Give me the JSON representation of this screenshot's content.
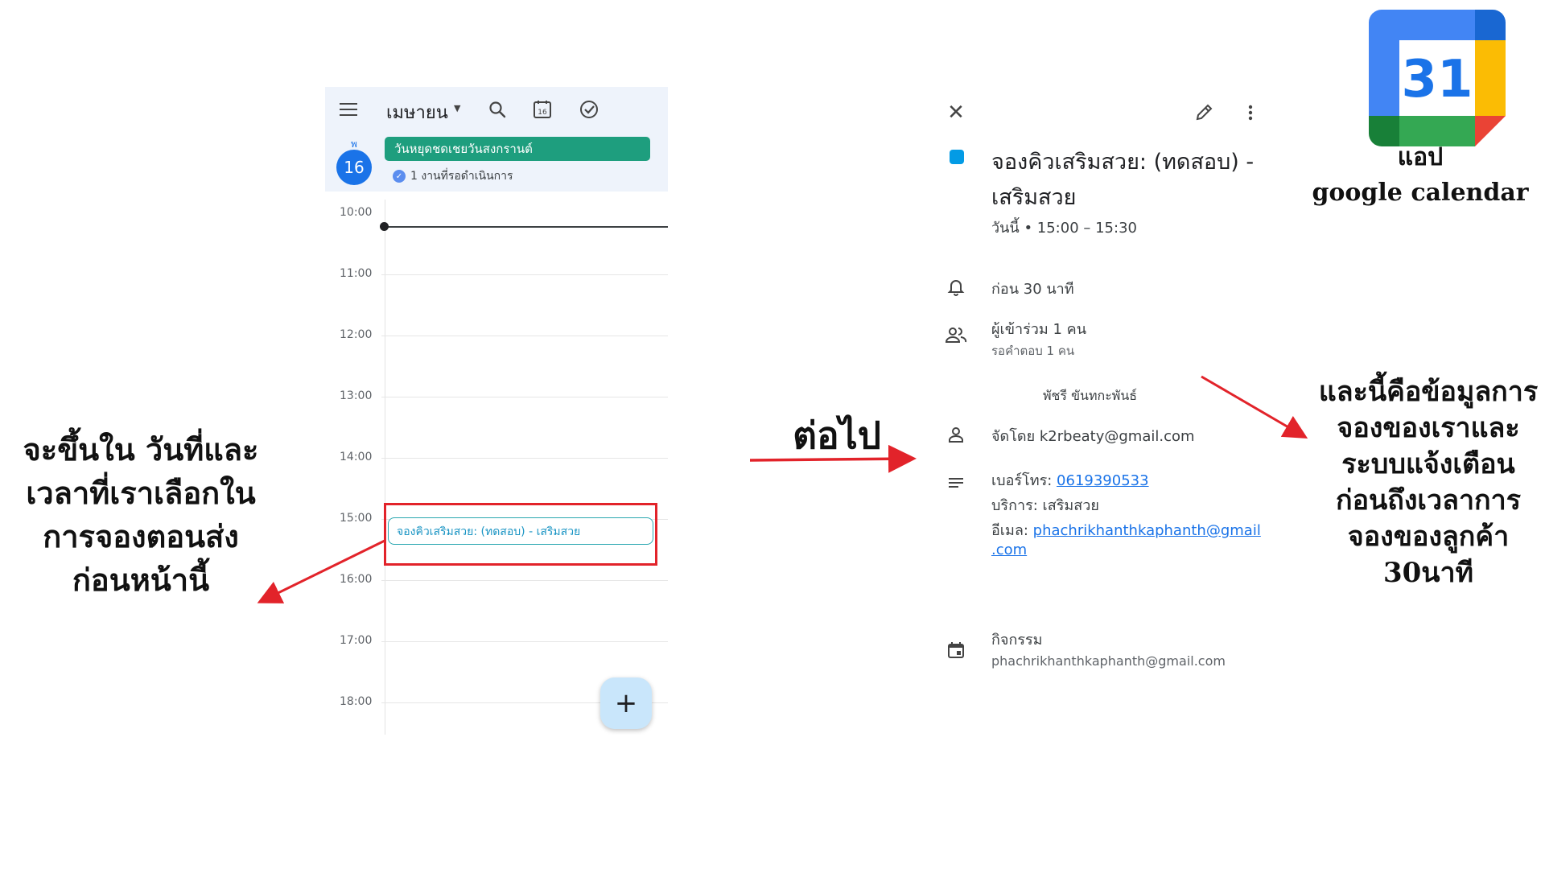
{
  "calendar_view": {
    "month_label": "เมษายน",
    "day_letter": "พ",
    "day_number": "16",
    "today_icon_number": "16",
    "holiday_event": "วันหยุดชดเชยวันสงกรานต์",
    "pending_tasks": "1 งานที่รอดำเนินการ",
    "hours": [
      "10:00",
      "11:00",
      "12:00",
      "13:00",
      "14:00",
      "15:00",
      "16:00",
      "17:00",
      "18:00"
    ],
    "event_chip": "จองคิวเสริมสวย: (ทดสอบ) - เสริมสวย",
    "fab_label": "+"
  },
  "event_detail": {
    "title": "จองคิวเสริมสวย: (ทดสอบ) - เสริมสวย",
    "time": "วันนี้  •  15:00 – 15:30",
    "reminder": "ก่อน 30 นาที",
    "guests_count": "ผู้เข้าร่วม 1 คน",
    "guests_pending": "รอคำตอบ 1 คน",
    "guest_name": "พัชรี ขันทกะพันธ์",
    "organizer": "จัดโดย k2rbeaty@gmail.com",
    "phone_label": "เบอร์โทร: ",
    "phone": "0619390533",
    "service": "บริการ: เสริมสวย",
    "email_label": "อีเมล: ",
    "email_line1": "phachrikhanthkaphanth@gmail",
    "email_line2": ".com",
    "calendar_name": "กิจกรรม",
    "calendar_owner": "phachrikhanthkaphanth@gmail.com",
    "color": "#039be5"
  },
  "annotations": {
    "left_note": [
      "จะขึ้นใน วันที่และ",
      "เวลาที่เราเลือกใน",
      "การจองตอนส่ง",
      "ก่อนหน้านี้"
    ],
    "next_note": "ต่อไป",
    "right_note": [
      "และนี้คือข้อมูลการ",
      "จองของเราและ",
      "ระบบแจ้งเตือน",
      "ก่อนถึงเวลาการ",
      "จองของลูกค้า",
      "30นาที"
    ],
    "app_title": [
      "แอป",
      "google calendar"
    ]
  },
  "logo": {
    "number": "31"
  },
  "colors": {
    "holiday_chip": "#1e9e7e",
    "event_border": "#2aa7b0",
    "highlight_red": "#e2232a",
    "accent_blue": "#1a73e8"
  }
}
